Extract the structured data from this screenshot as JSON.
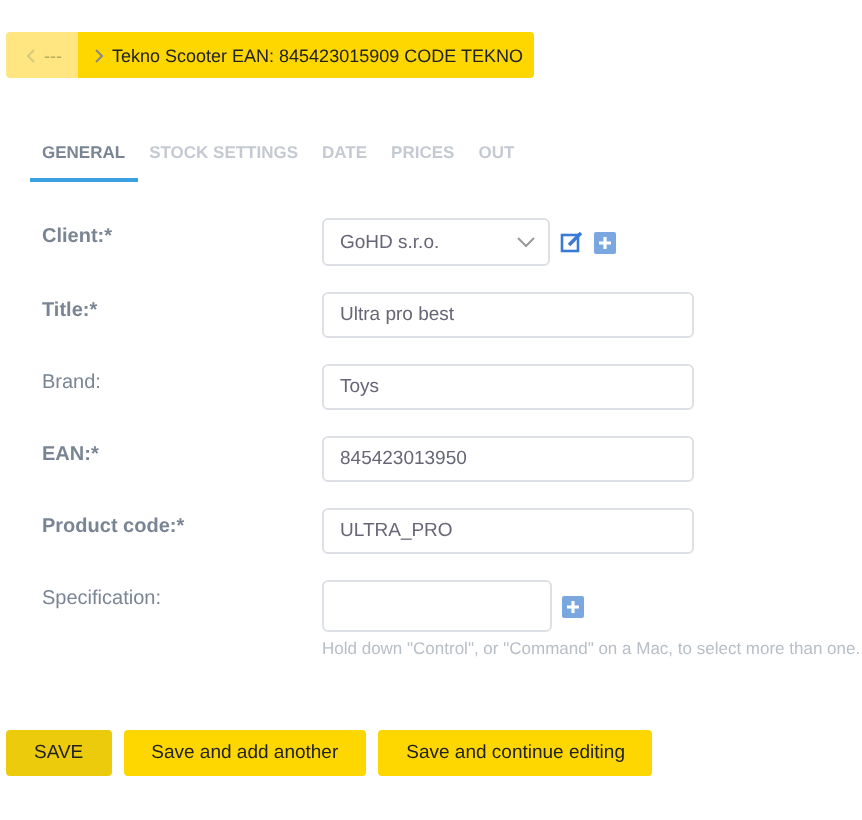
{
  "breadcrumb": {
    "back": "---",
    "current": "Tekno Scooter EAN: 845423015909 CODE TEKNO"
  },
  "tabs": [
    {
      "label": "GENERAL",
      "selected": true
    },
    {
      "label": "STOCK SETTINGS",
      "selected": false
    },
    {
      "label": "DATE",
      "selected": false
    },
    {
      "label": "PRICES",
      "selected": false
    },
    {
      "label": "OUT",
      "selected": false
    }
  ],
  "fields": [
    {
      "kind": "select",
      "label": "Client:*",
      "required": true,
      "value": "GoHD s.r.o."
    },
    {
      "kind": "text",
      "label": "Title:*",
      "required": true,
      "value": "Ultra pro best"
    },
    {
      "kind": "text",
      "label": "Brand:",
      "required": false,
      "value": "Toys"
    },
    {
      "kind": "text",
      "label": "EAN:*",
      "required": true,
      "value": "845423013950"
    },
    {
      "kind": "text",
      "label": "Product code:*",
      "required": true,
      "value": "ULTRA_PRO"
    },
    {
      "kind": "multiselect",
      "label": "Specification:",
      "required": false,
      "help": "Hold down \"Control\", or \"Command\" on a Mac, to select more than one."
    }
  ],
  "buttons": [
    {
      "label": "SAVE",
      "kind": "primary"
    },
    {
      "label": "Save and add another",
      "kind": "secondary"
    },
    {
      "label": "Save and continue editing",
      "kind": "secondary"
    }
  ]
}
